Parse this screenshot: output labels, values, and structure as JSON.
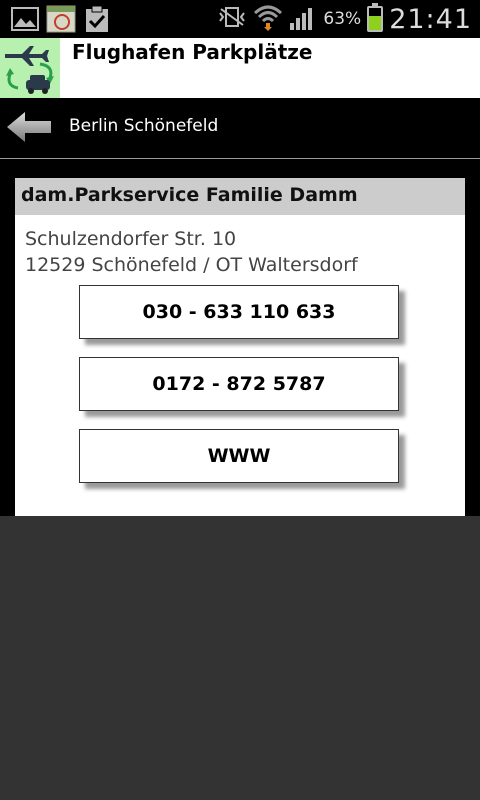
{
  "status_bar": {
    "battery_percent": "63%",
    "battery_level": 0.63,
    "time": "21:41",
    "left_icons": [
      "gallery-icon",
      "calendar-icon",
      "clipboard-check-icon"
    ],
    "right_icons": [
      "vibrate-icon",
      "wifi-icon",
      "signal-icon",
      "battery-icon"
    ]
  },
  "app": {
    "title": "Flughafen Parkplätze",
    "icon": "airport-parking-icon"
  },
  "nav": {
    "back_icon": "back-arrow-icon",
    "title": "Berlin Schönefeld"
  },
  "card": {
    "title": "dam.Parkservice Familie Damm",
    "address_line1": "Schulzendorfer Str. 10",
    "address_line2": "12529 Schönefeld / OT Waltersdorf",
    "buttons": [
      {
        "label": "030 - 633 110 633"
      },
      {
        "label": "0172 - 872 5787"
      },
      {
        "label": "WWW"
      }
    ]
  },
  "colors": {
    "battery_green": "#8ed11c",
    "card_header": "#cccccc",
    "background": "#333333",
    "app_icon_bg": "#b8f0b0"
  }
}
